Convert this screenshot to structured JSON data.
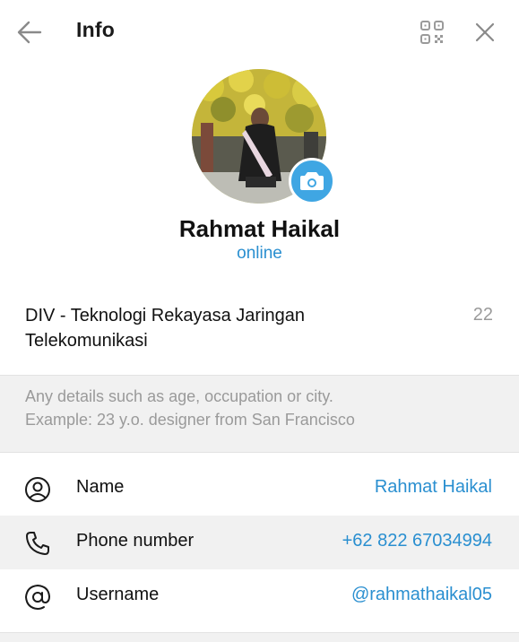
{
  "header": {
    "title": "Info",
    "back_icon": "arrow-left-icon",
    "qr_icon": "qr-code-icon",
    "close_icon": "close-icon"
  },
  "profile": {
    "name": "Rahmat Haikal",
    "status": "online",
    "camera_icon": "camera-icon"
  },
  "bio": {
    "text": "DIV - Teknologi Rekayasa Jaringan Telekomunikasi",
    "remaining": "22"
  },
  "hint": {
    "line1": "Any details such as age, occupation or city.",
    "line2": "Example: 23 y.o. designer from San Francisco"
  },
  "fields": [
    {
      "icon": "user-circle-icon",
      "label": "Name",
      "value": "Rahmat Haikal"
    },
    {
      "icon": "phone-icon",
      "label": "Phone number",
      "value": "+62 822 67034994"
    },
    {
      "icon": "at-sign-icon",
      "label": "Username",
      "value": "@rahmathaikal05"
    }
  ],
  "colors": {
    "accent": "#2a8fd0",
    "camera_button": "#3fa6e3",
    "muted_text": "#9a9a9a",
    "section_bg": "#f1f1f1"
  }
}
